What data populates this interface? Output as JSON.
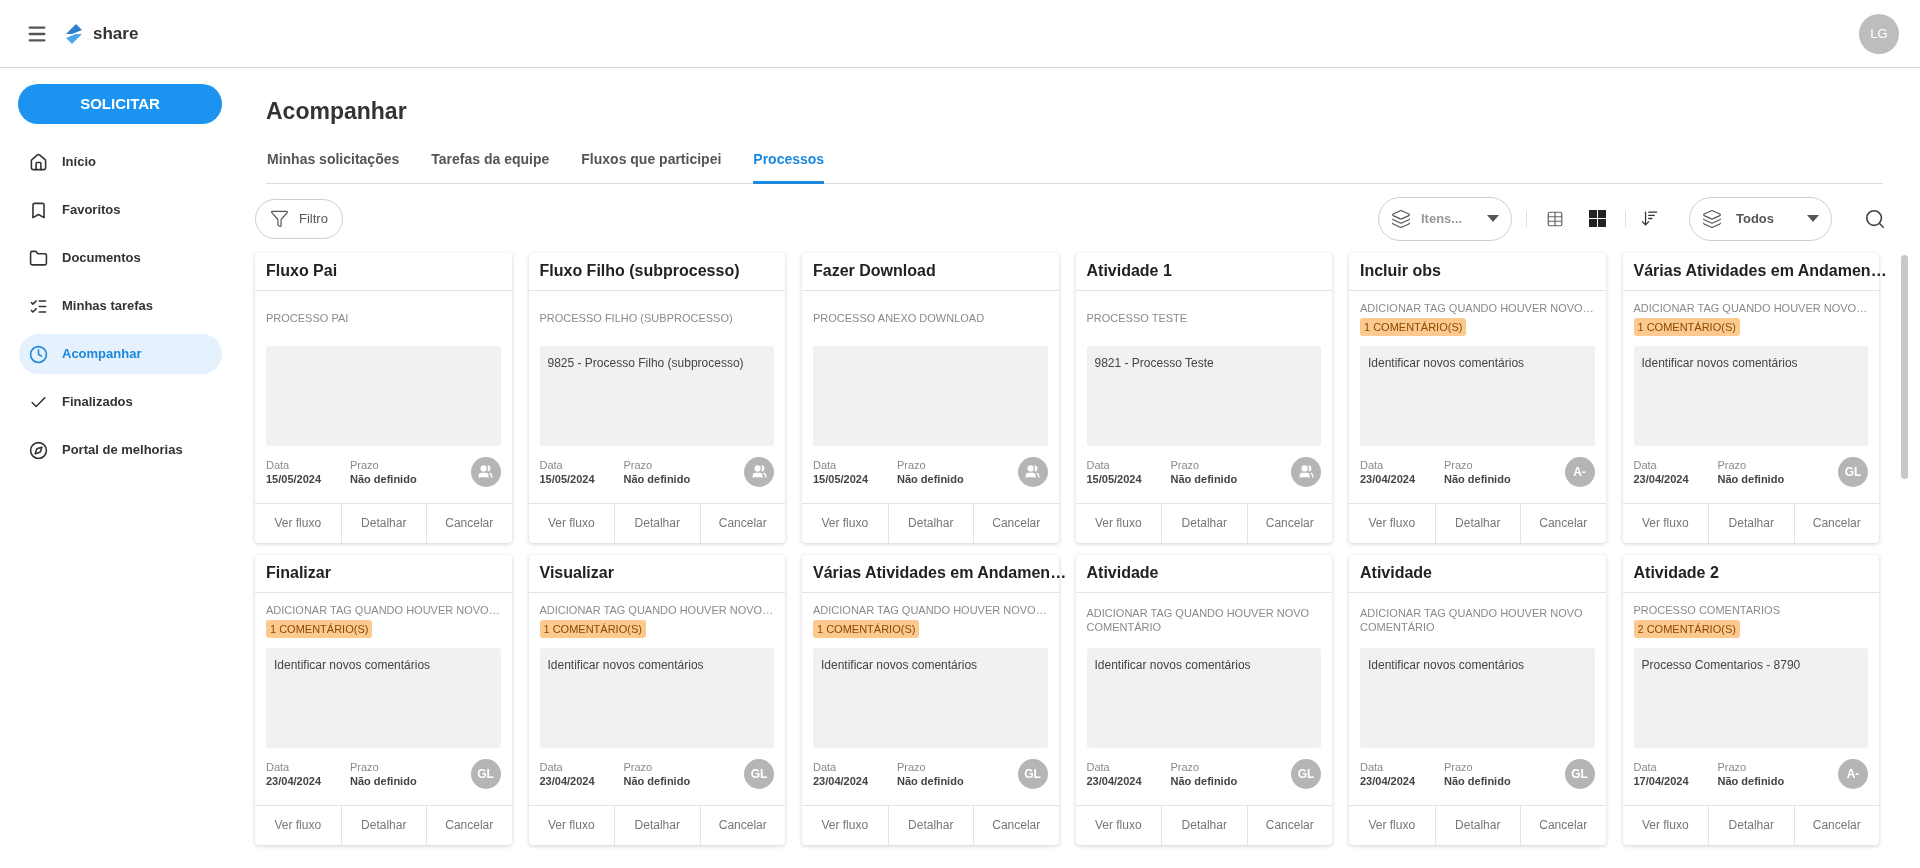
{
  "header": {
    "brand": "share",
    "avatar": "LG"
  },
  "sidebar": {
    "action": "SOLICITAR",
    "items": [
      {
        "label": "Início",
        "kind": "home",
        "selected": false
      },
      {
        "label": "Favoritos",
        "kind": "bookmark",
        "selected": false
      },
      {
        "label": "Documentos",
        "kind": "folder",
        "selected": false
      },
      {
        "label": "Minhas tarefas",
        "kind": "tasks",
        "selected": false
      },
      {
        "label": "Acompanhar",
        "kind": "clock",
        "selected": true
      },
      {
        "label": "Finalizados",
        "kind": "check",
        "selected": false
      },
      {
        "label": "Portal de melhorias",
        "kind": "compass",
        "selected": false
      }
    ]
  },
  "page_title": "Acompanhar",
  "tabs": [
    {
      "label": "Minhas solicitações",
      "selected": false
    },
    {
      "label": "Tarefas da equipe",
      "selected": false
    },
    {
      "label": "Fluxos que participei",
      "selected": false
    },
    {
      "label": "Processos",
      "selected": true
    }
  ],
  "toolbar": {
    "filter": "Filtro",
    "items_select": "Itens...",
    "views": [
      {
        "kind": "table",
        "selected": false
      },
      {
        "kind": "grid",
        "selected": true
      }
    ],
    "scope_select": "Todos"
  },
  "cards": [
    {
      "title": "Fluxo Pai",
      "subtitle": "PROCESSO PAI",
      "date_label": "Data",
      "date": "15/05/2024",
      "deadline_label": "Prazo",
      "deadline": "Não definido",
      "assignee": {
        "kind": "group"
      },
      "actions": [
        "Ver fluxo",
        "Detalhar",
        "Cancelar"
      ]
    },
    {
      "title": "Fluxo Filho (subprocesso)",
      "subtitle": "PROCESSO FILHO (SUBPROCESSO)",
      "description": "9825 - Processo Filho (subprocesso)",
      "date_label": "Data",
      "date": "15/05/2024",
      "deadline_label": "Prazo",
      "deadline": "Não definido",
      "assignee": {
        "kind": "group"
      },
      "actions": [
        "Ver fluxo",
        "Detalhar",
        "Cancelar"
      ]
    },
    {
      "title": "Fazer Download",
      "subtitle": "PROCESSO ANEXO DOWNLOAD",
      "date_label": "Data",
      "date": "15/05/2024",
      "deadline_label": "Prazo",
      "deadline": "Não definido",
      "assignee": {
        "kind": "group"
      },
      "actions": [
        "Ver fluxo",
        "Detalhar",
        "Cancelar"
      ]
    },
    {
      "title": "Atividade 1",
      "subtitle": "PROCESSO TESTE",
      "description": "9821 - Processo Teste",
      "date_label": "Data",
      "date": "15/05/2024",
      "deadline_label": "Prazo",
      "deadline": "Não definido",
      "assignee": {
        "kind": "group"
      },
      "actions": [
        "Ver fluxo",
        "Detalhar",
        "Cancelar"
      ]
    },
    {
      "title": "Incluir obs",
      "subtitle": "ADICIONAR TAG QUANDO HOUVER NOVO…",
      "tag": "1 COMENTÁRIO(S)",
      "description": "Identificar novos comentários",
      "date_label": "Data",
      "date": "23/04/2024",
      "deadline_label": "Prazo",
      "deadline": "Não definido",
      "assignee": {
        "kind": "initials",
        "text": "A-"
      },
      "actions": [
        "Ver fluxo",
        "Detalhar",
        "Cancelar"
      ]
    },
    {
      "title": "Várias Atividades em Andamen…",
      "subtitle": "ADICIONAR TAG QUANDO HOUVER NOVO…",
      "tag": "1 COMENTÁRIO(S)",
      "description": "Identificar novos comentários",
      "date_label": "Data",
      "date": "23/04/2024",
      "deadline_label": "Prazo",
      "deadline": "Não definido",
      "assignee": {
        "kind": "initials",
        "text": "GL"
      },
      "actions": [
        "Ver fluxo",
        "Detalhar",
        "Cancelar"
      ]
    },
    {
      "title": "Finalizar",
      "subtitle": "ADICIONAR TAG QUANDO HOUVER NOVO…",
      "tag": "1 COMENTÁRIO(S)",
      "description": "Identificar novos comentários",
      "date_label": "Data",
      "date": "23/04/2024",
      "deadline_label": "Prazo",
      "deadline": "Não definido",
      "assignee": {
        "kind": "initials",
        "text": "GL"
      },
      "actions": [
        "Ver fluxo",
        "Detalhar",
        "Cancelar"
      ]
    },
    {
      "title": "Visualizar",
      "subtitle": "ADICIONAR TAG QUANDO HOUVER NOVO…",
      "tag": "1 COMENTÁRIO(S)",
      "description": "Identificar novos comentários",
      "date_label": "Data",
      "date": "23/04/2024",
      "deadline_label": "Prazo",
      "deadline": "Não definido",
      "assignee": {
        "kind": "initials",
        "text": "GL"
      },
      "actions": [
        "Ver fluxo",
        "Detalhar",
        "Cancelar"
      ]
    },
    {
      "title": "Várias Atividades em Andamen…",
      "subtitle": "ADICIONAR TAG QUANDO HOUVER NOVO…",
      "tag": "1 COMENTÁRIO(S)",
      "description": "Identificar novos comentários",
      "date_label": "Data",
      "date": "23/04/2024",
      "deadline_label": "Prazo",
      "deadline": "Não definido",
      "assignee": {
        "kind": "initials",
        "text": "GL"
      },
      "actions": [
        "Ver fluxo",
        "Detalhar",
        "Cancelar"
      ]
    },
    {
      "title": "Atividade",
      "subtitle": "ADICIONAR TAG QUANDO HOUVER NOVO COMENTÁRIO",
      "description": "Identificar novos comentários",
      "date_label": "Data",
      "date": "23/04/2024",
      "deadline_label": "Prazo",
      "deadline": "Não definido",
      "assignee": {
        "kind": "initials",
        "text": "GL"
      },
      "actions": [
        "Ver fluxo",
        "Detalhar",
        "Cancelar"
      ]
    },
    {
      "title": "Atividade",
      "subtitle": "ADICIONAR TAG QUANDO HOUVER NOVO COMENTÁRIO",
      "description": "Identificar novos comentários",
      "date_label": "Data",
      "date": "23/04/2024",
      "deadline_label": "Prazo",
      "deadline": "Não definido",
      "assignee": {
        "kind": "initials",
        "text": "GL"
      },
      "actions": [
        "Ver fluxo",
        "Detalhar",
        "Cancelar"
      ]
    },
    {
      "title": "Atividade 2",
      "subtitle": "PROCESSO COMENTARIOS",
      "tag": "2 COMENTÁRIO(S)",
      "description": "Processo Comentarios - 8790",
      "date_label": "Data",
      "date": "17/04/2024",
      "deadline_label": "Prazo",
      "deadline": "Não definido",
      "assignee": {
        "kind": "initials",
        "text": "A-"
      },
      "actions": [
        "Ver fluxo",
        "Detalhar",
        "Cancelar"
      ]
    }
  ]
}
